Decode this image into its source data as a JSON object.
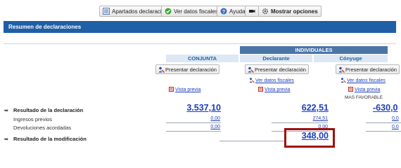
{
  "toolbar": {
    "apartados_label": "Apartados declaración",
    "ver_datos_label": "Ver datos fiscales",
    "ayuda_label": "Ayuda",
    "mostrar_label": "Mostrar opciones"
  },
  "header": {
    "title": "Resumen de declaraciones"
  },
  "columns": {
    "individuales": "INDIVIDUALES",
    "conjunta": "CONJUNTA",
    "declarante": "Declarante",
    "conyuge": "Cónyuge"
  },
  "actions": {
    "presentar_label": "Presentar declaración",
    "ver_datos_fiscales_link": "Ver datos fiscales",
    "vista_previa_link": "Vista previa",
    "mas_favorable": "MAS FAVORABLE"
  },
  "rows": {
    "resultado_declaracion": {
      "label": "Resultado de la declaración",
      "conjunta": "3.537,10",
      "declarante": "622,51",
      "conyuge": "-630,0"
    },
    "ingresos_previos": {
      "label": "Ingresos previos",
      "conjunta": "0,00",
      "declarante": "274,51",
      "conyuge": "0,0"
    },
    "devoluciones_acordadas": {
      "label": "Devoluciones acordadas",
      "conjunta": "0,00",
      "declarante": "0,00",
      "conyuge": "0,0"
    },
    "resultado_modificacion": {
      "label": "Resultado de la modificación",
      "declarante": "348,00"
    }
  },
  "colors": {
    "header_blue": "#1e5fa6",
    "link_blue": "#1a3fb8",
    "highlight_red": "#a01010"
  }
}
